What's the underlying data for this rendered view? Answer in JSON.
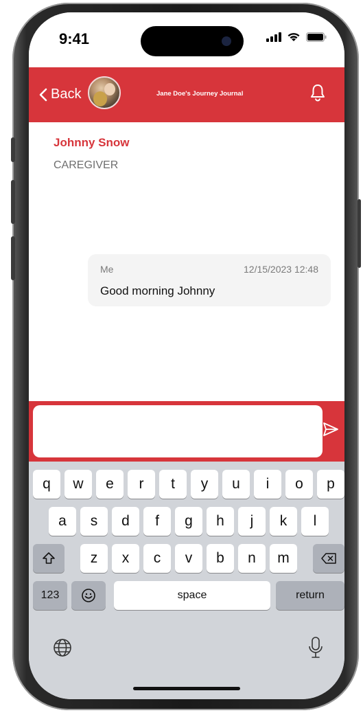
{
  "status_bar": {
    "time": "9:41"
  },
  "header": {
    "back_label": "Back",
    "journal_title": "Jane Doe's Journey Journal",
    "accent_color": "#d7353b"
  },
  "contact": {
    "name": "Johnny Snow",
    "role": "CAREGIVER"
  },
  "messages": [
    {
      "sender": "Me",
      "timestamp": "12/15/2023 12:48",
      "text": "Good morning Johnny"
    }
  ],
  "composer": {
    "value": "",
    "send_icon": "send-icon"
  },
  "keyboard": {
    "row1": [
      "q",
      "w",
      "e",
      "r",
      "t",
      "y",
      "u",
      "i",
      "o",
      "p"
    ],
    "row2": [
      "a",
      "s",
      "d",
      "f",
      "g",
      "h",
      "j",
      "k",
      "l"
    ],
    "row3": [
      "z",
      "x",
      "c",
      "v",
      "b",
      "n",
      "m"
    ],
    "numbers_label": "123",
    "space_label": "space",
    "return_label": "return"
  }
}
